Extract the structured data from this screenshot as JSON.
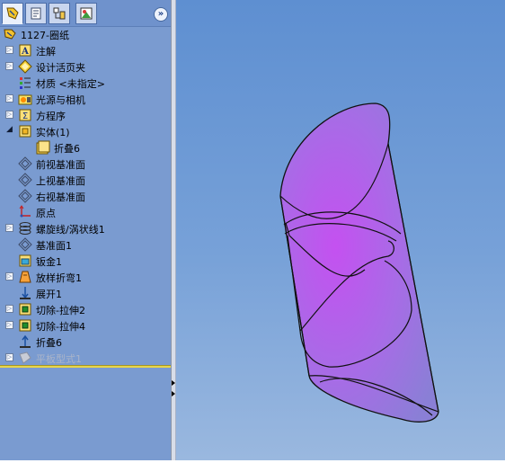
{
  "panel_tabs": [
    {
      "name": "featuremanager-tab",
      "icon": "feature-tree-icon",
      "active": true
    },
    {
      "name": "propertymanager-tab",
      "icon": "property-icon",
      "active": false
    },
    {
      "name": "configurationmanager-tab",
      "icon": "configuration-icon",
      "active": false
    },
    {
      "name": "displaymanager-tab",
      "icon": "appearance-icon",
      "active": false
    }
  ],
  "collapse_button": "»",
  "tree": {
    "root": {
      "label": "1127-圈纸",
      "icon": "part-icon"
    },
    "items": [
      {
        "label": "注解",
        "icon": "annotations-icon",
        "expander": "+"
      },
      {
        "label": "设计活页夹",
        "icon": "design-binder-icon",
        "expander": "+"
      },
      {
        "label": "材质 <未指定>",
        "icon": "material-icon",
        "expander": ""
      },
      {
        "label": "光源与相机",
        "icon": "lights-cameras-icon",
        "expander": "+"
      },
      {
        "label": "方程序",
        "icon": "equations-icon",
        "expander": "+"
      },
      {
        "label": "实体(1)",
        "icon": "solid-bodies-icon",
        "expander": "−"
      },
      {
        "label": "折叠6",
        "icon": "body-icon",
        "expander": "",
        "child": true
      },
      {
        "label": "前视基准面",
        "icon": "plane-icon",
        "expander": ""
      },
      {
        "label": "上视基准面",
        "icon": "plane-icon",
        "expander": ""
      },
      {
        "label": "右视基准面",
        "icon": "plane-icon",
        "expander": ""
      },
      {
        "label": "原点",
        "icon": "origin-icon",
        "expander": ""
      },
      {
        "label": "螺旋线/涡状线1",
        "icon": "helix-icon",
        "expander": "+"
      },
      {
        "label": "基准面1",
        "icon": "plane-icon",
        "expander": ""
      },
      {
        "label": "钣金1",
        "icon": "sheet-metal-icon",
        "expander": ""
      },
      {
        "label": "放样折弯1",
        "icon": "lofted-bend-icon",
        "expander": "+"
      },
      {
        "label": "展开1",
        "icon": "unfold-icon",
        "expander": ""
      },
      {
        "label": "切除-拉伸2",
        "icon": "cut-extrude-icon",
        "expander": "+"
      },
      {
        "label": "切除-拉伸4",
        "icon": "cut-extrude-icon",
        "expander": "+"
      },
      {
        "label": "折叠6",
        "icon": "fold-icon",
        "expander": ""
      },
      {
        "label": "平板型式1",
        "icon": "flat-pattern-icon",
        "expander": "+",
        "suppressed": true
      }
    ]
  },
  "colors": {
    "panel_bg": "#7a9bd0",
    "rollback_bar": "#e8d64a",
    "viewport_top": "#5e8fd1",
    "viewport_bottom": "#9ab8df",
    "model_fill": "#b36be8"
  }
}
